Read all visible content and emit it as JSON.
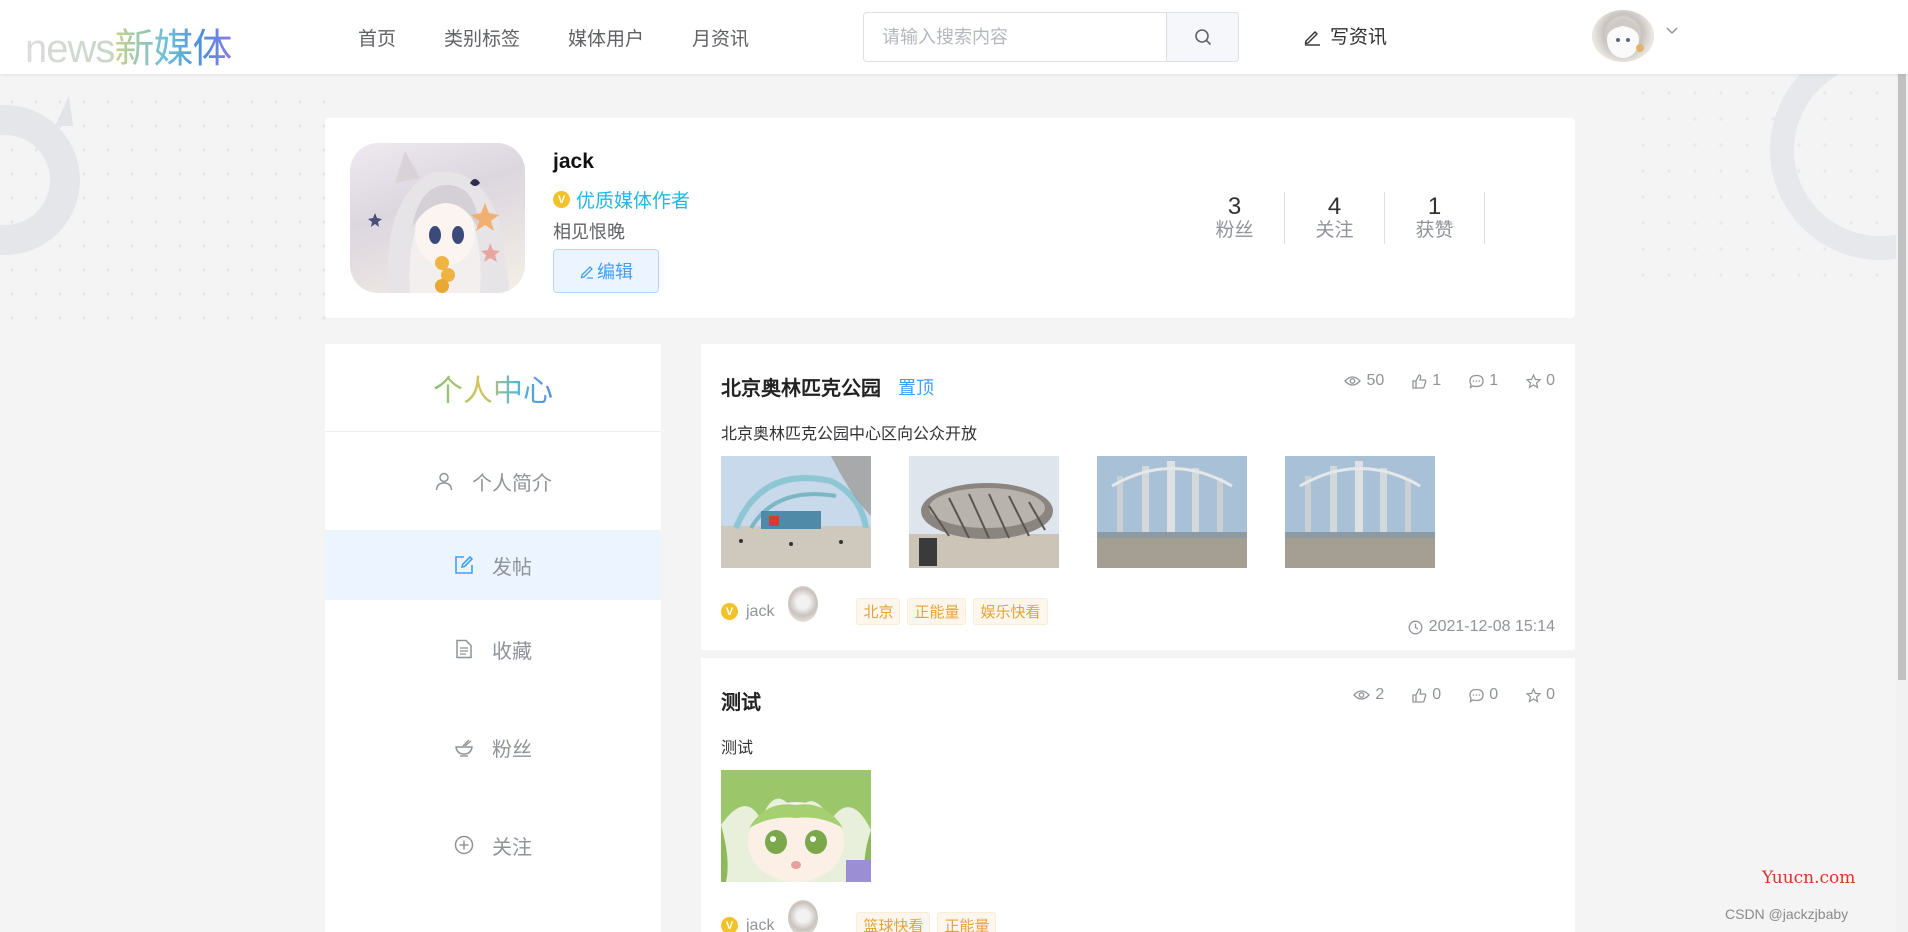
{
  "header": {
    "logo_en": "news",
    "logo_cn": "新媒体",
    "nav": [
      {
        "label": "首页"
      },
      {
        "label": "类别标签"
      },
      {
        "label": "媒体用户"
      },
      {
        "label": "月资讯"
      }
    ],
    "search_placeholder": "请输入搜索内容",
    "write_label": "写资讯"
  },
  "profile": {
    "name": "jack",
    "badge": "优质媒体作者",
    "motto": "相见恨晚",
    "edit_label": "编辑",
    "stats": [
      {
        "num": "3",
        "label": "粉丝"
      },
      {
        "num": "4",
        "label": "关注"
      },
      {
        "num": "1",
        "label": "获赞"
      }
    ]
  },
  "sidebar": {
    "title": "个人中心",
    "items": [
      {
        "label": "个人简介",
        "icon": "user-icon"
      },
      {
        "label": "发帖",
        "icon": "edit-icon"
      },
      {
        "label": "收藏",
        "icon": "document-icon"
      },
      {
        "label": "粉丝",
        "icon": "bowl-icon"
      },
      {
        "label": "关注",
        "icon": "circle-plus-icon"
      }
    ],
    "active_index": 1
  },
  "posts": [
    {
      "title": "北京奥林匹克公园",
      "pin": "置顶",
      "views": "50",
      "likes": "1",
      "comments": "1",
      "stars": "0",
      "desc": "北京奥林匹克公园中心区向公众开放",
      "author": "jack",
      "tags": [
        "北京",
        "正能量",
        "娱乐快看"
      ],
      "time": "2021-12-08 15:14"
    },
    {
      "title": "测试",
      "views": "2",
      "likes": "0",
      "comments": "0",
      "stars": "0",
      "desc": "测试",
      "author": "jack",
      "tags": [
        "篮球快看",
        "正能量"
      ]
    }
  ],
  "watermark": {
    "site": "Yuucn.com",
    "credit": "CSDN @jackzjbaby"
  },
  "colors": {
    "primary": "#409eff",
    "badge_text": "#22b7e6",
    "tag_text": "#e6a23c",
    "page_bg": "#f4f4f5"
  }
}
